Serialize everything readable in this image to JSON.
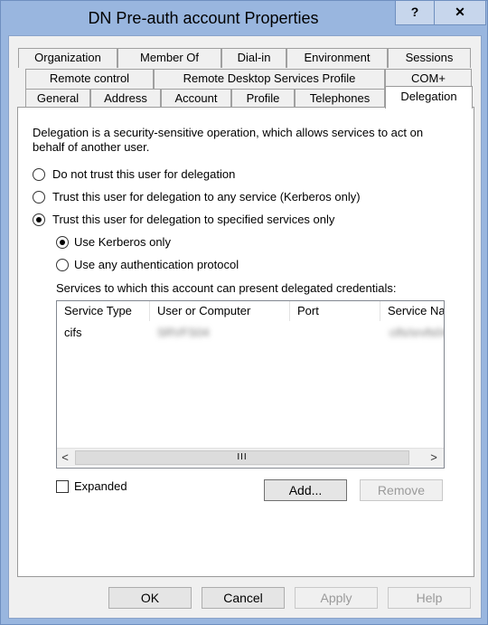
{
  "window": {
    "title": "DN Pre-auth account Properties",
    "help_label": "?",
    "close_label": "✕"
  },
  "tabs": {
    "row1": [
      "Organization",
      "Member Of",
      "Dial-in",
      "Environment",
      "Sessions"
    ],
    "row2": [
      "Remote control",
      "Remote Desktop Services Profile",
      "COM+"
    ],
    "row3": [
      "General",
      "Address",
      "Account",
      "Profile",
      "Telephones",
      "Delegation"
    ],
    "active": "Delegation"
  },
  "delegation": {
    "description_line1": "Delegation is a security-sensitive operation, which allows services to act on",
    "description_line2": "behalf of another user.",
    "options": [
      {
        "label": "Do not trust this user for delegation",
        "checked": false
      },
      {
        "label": "Trust this user for delegation to any service (Kerberos only)",
        "checked": false
      },
      {
        "label": "Trust this user for delegation to specified services only",
        "checked": true
      }
    ],
    "sub_options": [
      {
        "label": "Use Kerberos only",
        "checked": true
      },
      {
        "label": "Use any authentication protocol",
        "checked": false
      }
    ],
    "services_label": "Services to which this account can present delegated credentials:",
    "columns": [
      "Service Type",
      "User or Computer",
      "Port",
      "Service Na"
    ],
    "rows": [
      {
        "service_type": "cifs",
        "user_or_computer": "SRVFS04",
        "port": "",
        "service_name": "cifs/srvfs04"
      }
    ],
    "scroll_left": "<",
    "scroll_right": ">",
    "scroll_thumb": "III",
    "expanded_label": "Expanded",
    "add_label": "Add...",
    "remove_label": "Remove"
  },
  "footer": {
    "ok_label": "OK",
    "cancel_label": "Cancel",
    "apply_label": "Apply",
    "help_label": "Help"
  }
}
